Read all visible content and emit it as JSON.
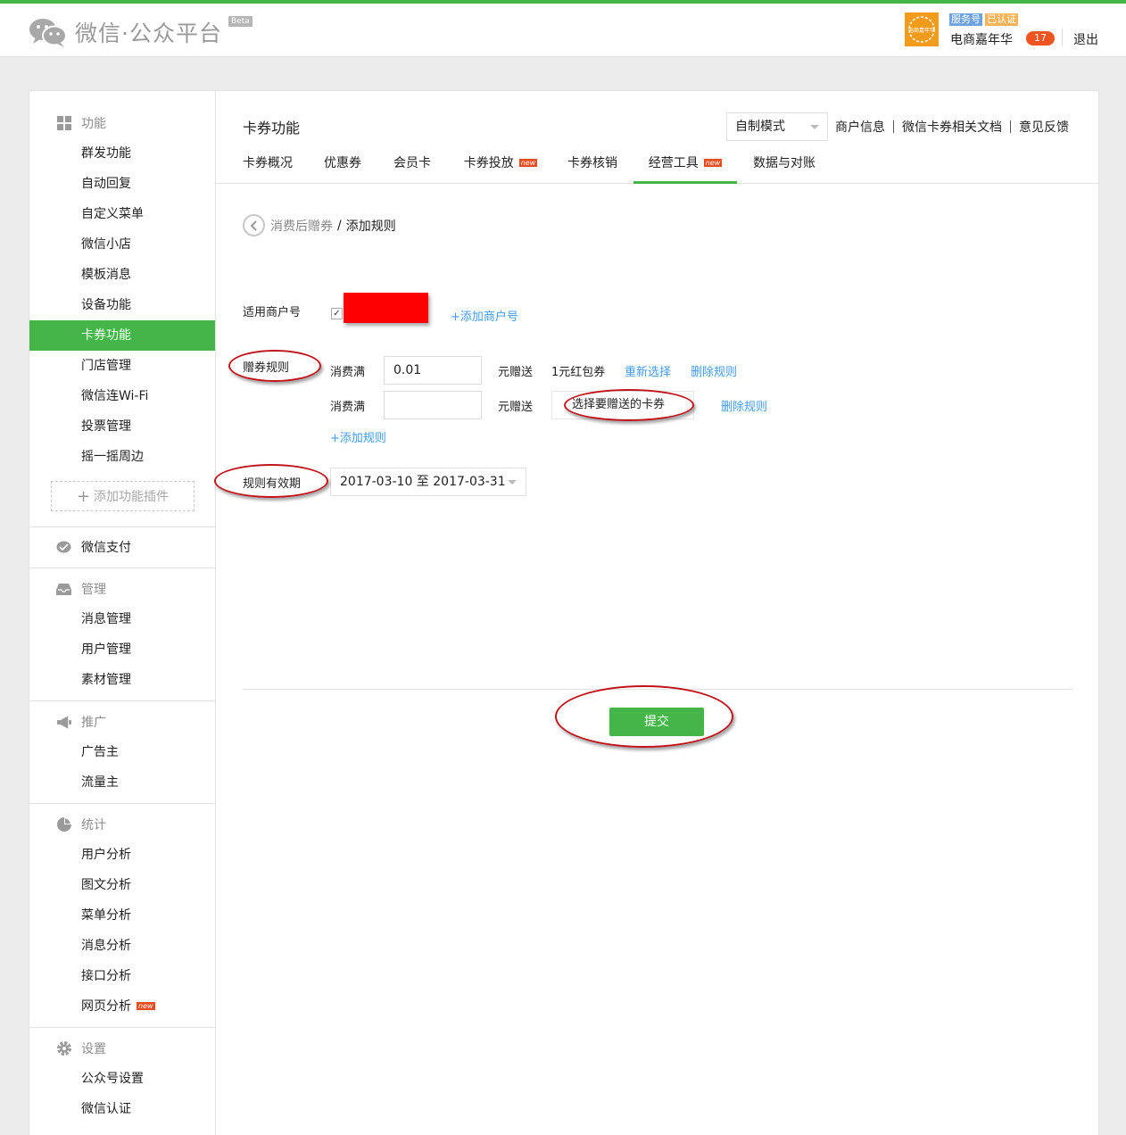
{
  "header": {
    "logo_text": "微信·公众平台",
    "beta": "Beta",
    "avatar_text": "电商嘉年华",
    "tag_service": "服务号",
    "tag_verified": "已认证",
    "account_name": "电商嘉年华",
    "badge_count": "17",
    "logout": "退出"
  },
  "sidebar": {
    "sec_function": "功能",
    "function_items": [
      "群发功能",
      "自动回复",
      "自定义菜单",
      "微信小店",
      "模板消息",
      "设备功能",
      "卡券功能",
      "门店管理",
      "微信连Wi-Fi",
      "投票管理",
      "摇一摇周边"
    ],
    "active_item": "卡券功能",
    "add_plugin": "添加功能插件",
    "sec_pay": "微信支付",
    "sec_manage": "管理",
    "manage_items": [
      "消息管理",
      "用户管理",
      "素材管理"
    ],
    "sec_promo": "推广",
    "promo_items": [
      "广告主",
      "流量主"
    ],
    "sec_stats": "统计",
    "stats_items": [
      "用户分析",
      "图文分析",
      "菜单分析",
      "消息分析",
      "接口分析",
      "网页分析"
    ],
    "new_tag": "new",
    "sec_settings": "设置",
    "settings_items": [
      "公众号设置",
      "微信认证"
    ]
  },
  "main": {
    "title": "卡券功能",
    "mode": "自制模式",
    "top_links": [
      "商户信息",
      "微信卡券相关文档",
      "意见反馈"
    ],
    "tabs": [
      "卡券概况",
      "优惠券",
      "会员卡",
      "卡券投放",
      "卡券核销",
      "经营工具",
      "数据与对账"
    ],
    "active_tab": "经营工具",
    "breadcrumb_parent": "消费后赠券",
    "breadcrumb_sep": "/",
    "breadcrumb_current": "添加规则",
    "merchant_label": "适用商户号",
    "add_merchant": "+添加商户号",
    "rule_label": "赠券规则",
    "rule1": {
      "prefix": "消费满",
      "amount": "0.01",
      "mid": "元赠送",
      "gift": "1元红包券",
      "reselect": "重新选择",
      "delete": "删除规则"
    },
    "rule2": {
      "prefix": "消费满",
      "amount": "",
      "mid": "元赠送",
      "choose": "选择要赠送的卡券",
      "delete": "删除规则"
    },
    "add_rule": "+添加规则",
    "validity_label": "规则有效期",
    "date_range": "2017-03-10 至 2017-03-31",
    "submit": "提交"
  },
  "colors": {
    "brand_green": "#44b549",
    "link_blue": "#459ae9",
    "annotation_red": "#c0141c",
    "badge": "#f0541e"
  }
}
